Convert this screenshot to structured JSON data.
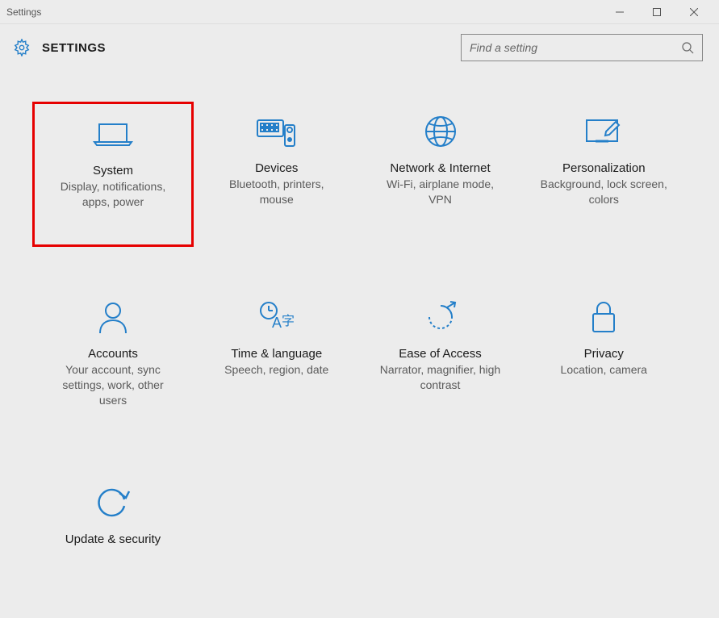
{
  "window": {
    "title": "Settings"
  },
  "header": {
    "title": "SETTINGS"
  },
  "search": {
    "placeholder": "Find a setting"
  },
  "tiles": [
    {
      "title": "System",
      "desc": "Display, notifications, apps, power",
      "highlighted": true
    },
    {
      "title": "Devices",
      "desc": "Bluetooth, printers, mouse"
    },
    {
      "title": "Network & Internet",
      "desc": "Wi-Fi, airplane mode, VPN"
    },
    {
      "title": "Personalization",
      "desc": "Background, lock screen, colors"
    },
    {
      "title": "Accounts",
      "desc": "Your account, sync settings, work, other users"
    },
    {
      "title": "Time & language",
      "desc": "Speech, region, date"
    },
    {
      "title": "Ease of Access",
      "desc": "Narrator, magnifier, high contrast"
    },
    {
      "title": "Privacy",
      "desc": "Location, camera"
    },
    {
      "title": "Update & security",
      "desc": ""
    }
  ]
}
